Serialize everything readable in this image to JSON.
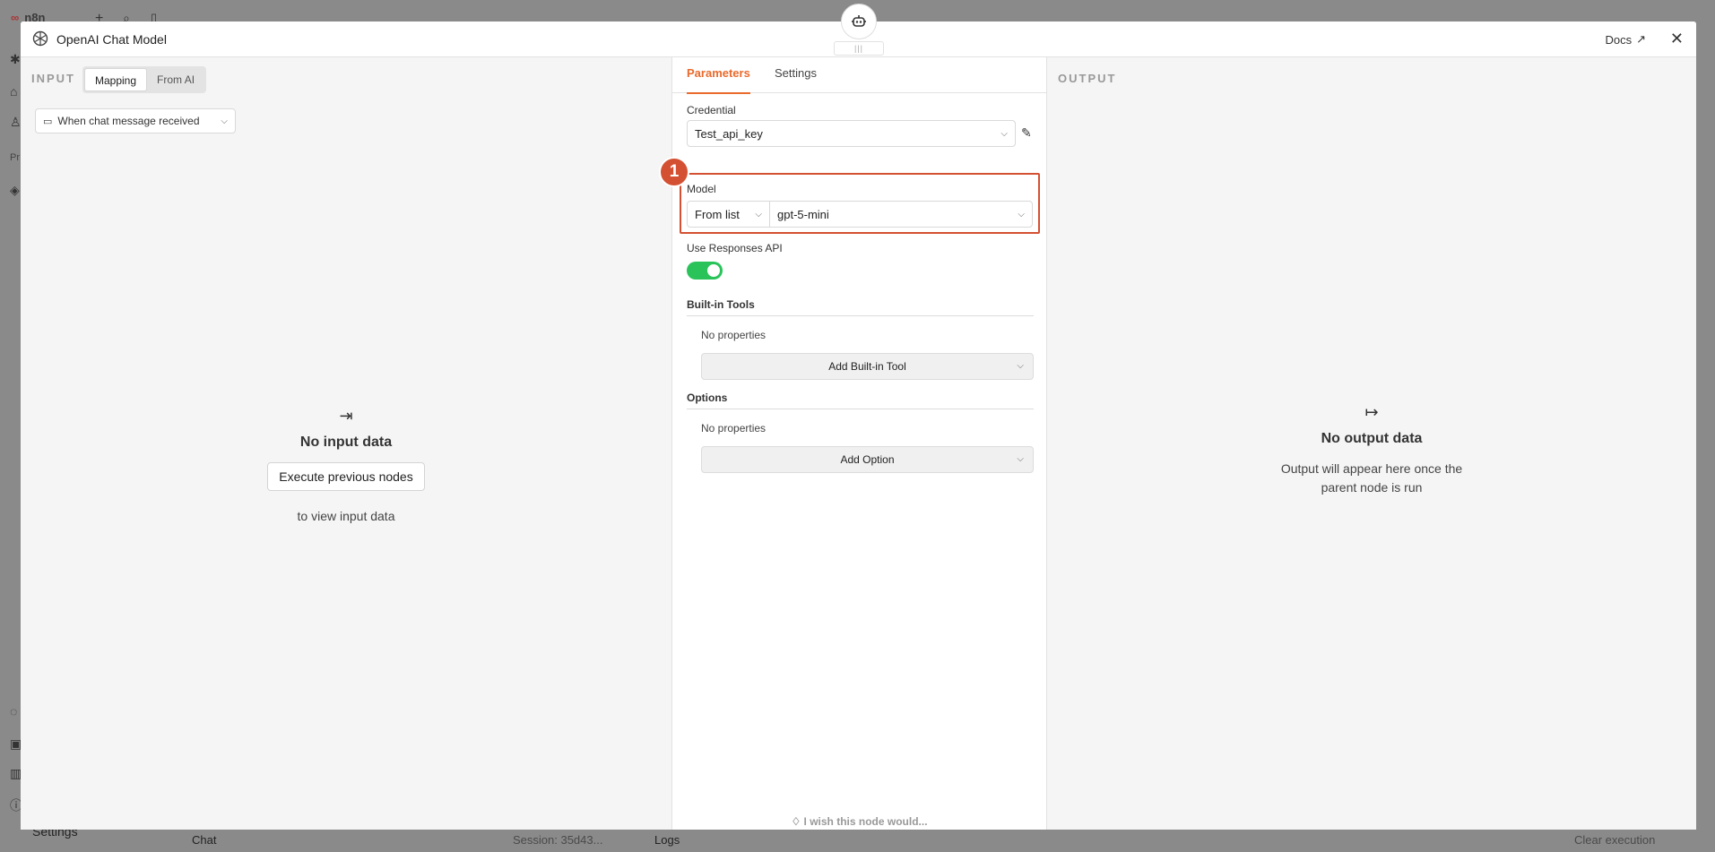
{
  "background": {
    "app_name": "n8n",
    "sidebar_bottom_label": "Settings",
    "chat_label": "Chat",
    "session_text": "Session: 35d43...",
    "logs_label": "Logs",
    "clear_execution_label": "Clear execution",
    "sidebar_partial_label": "Pr"
  },
  "modal": {
    "title": "OpenAI Chat Model",
    "docs_label": "Docs",
    "close_glyph": "✕",
    "drag_glyph": "|||"
  },
  "input_panel": {
    "label": "INPUT",
    "mapping_tabs": [
      "Mapping",
      "From AI"
    ],
    "trigger_node": "When chat message received",
    "empty_title": "No input data",
    "execute_button": "Execute previous nodes",
    "empty_subtitle": "to view input data"
  },
  "params_panel": {
    "tabs": [
      "Parameters",
      "Settings"
    ],
    "credential_label": "Credential",
    "credential_value": "Test_api_key",
    "step_number": "1",
    "model_label": "Model",
    "model_mode": "From list",
    "model_value": "gpt-5-mini",
    "responses_api_label": "Use Responses API",
    "responses_api_enabled": true,
    "builtin_tools_label": "Built-in Tools",
    "builtin_tools_empty": "No properties",
    "add_builtin_tool": "Add Built-in Tool",
    "options_label": "Options",
    "options_empty": "No properties",
    "add_option": "Add Option",
    "wish_text": "I wish this node would..."
  },
  "output_panel": {
    "label": "OUTPUT",
    "empty_title": "No output data",
    "empty_subtitle_line1": "Output will appear here once the",
    "empty_subtitle_line2": "parent node is run"
  },
  "colors": {
    "accent": "#ea6a2c",
    "highlight": "#d45032",
    "toggle_on": "#2ac35a"
  }
}
